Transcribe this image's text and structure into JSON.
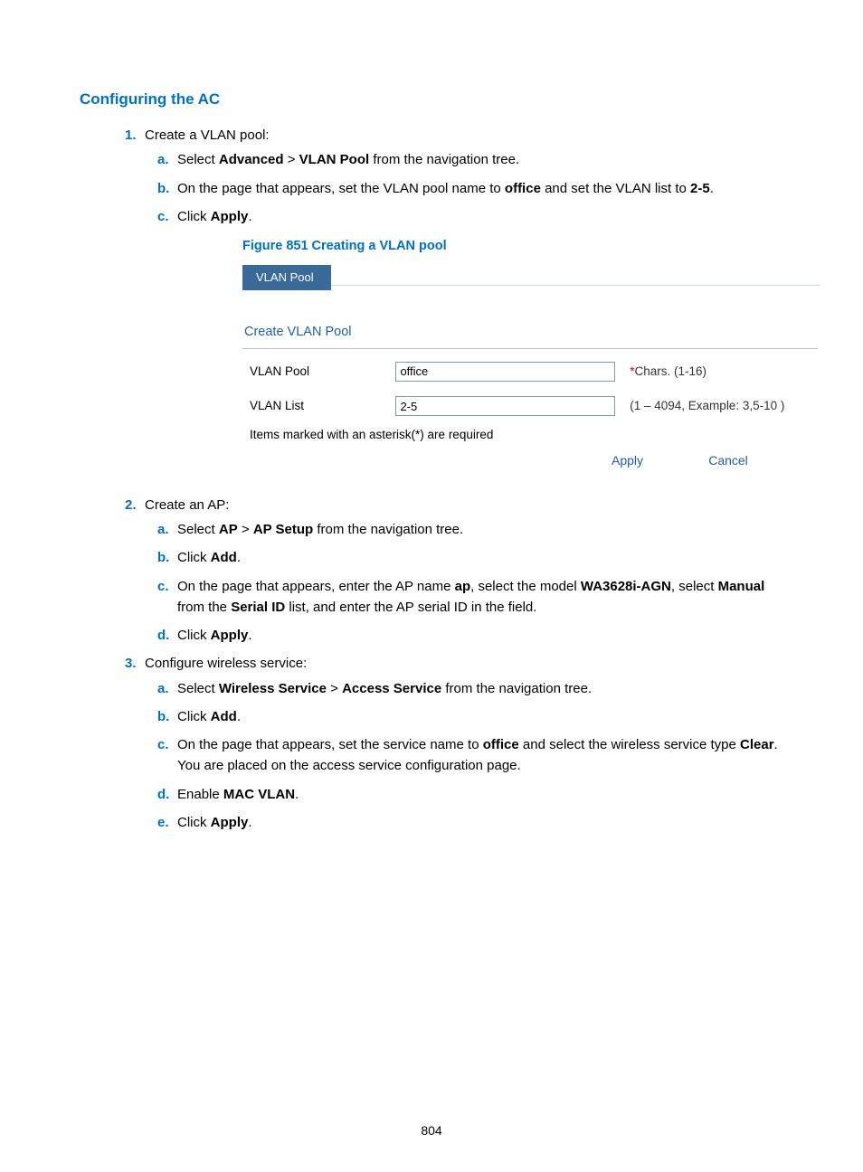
{
  "heading": "Configuring the AC",
  "step1": {
    "marker": "1.",
    "text": "Create a VLAN pool:",
    "a_marker": "a.",
    "a_pre": "Select ",
    "a_b1": "Advanced",
    "a_mid": " > ",
    "a_b2": "VLAN Pool",
    "a_post": " from the navigation tree.",
    "b_marker": "b.",
    "b_pre": "On the page that appears, set the VLAN pool name to ",
    "b_b1": "office",
    "b_mid": " and set the VLAN list to ",
    "b_b2": "2-5",
    "b_post": ".",
    "c_marker": "c.",
    "c_pre": "Click ",
    "c_b1": "Apply",
    "c_post": "."
  },
  "figure": {
    "title": "Figure 851 Creating a VLAN pool",
    "tab_label": "VLAN Pool",
    "subhead": "Create VLAN Pool",
    "row1_label": "VLAN Pool",
    "row1_value": "office",
    "row1_hint_star": "*",
    "row1_hint": "Chars. (1-16)",
    "row2_label": "VLAN List",
    "row2_value": "2-5",
    "row2_hint": "(1 – 4094, Example: 3,5-10 )",
    "required_note": "Items marked with an asterisk(*) are required",
    "apply_label": "Apply",
    "cancel_label": "Cancel"
  },
  "step2": {
    "marker": "2.",
    "text": "Create an AP:",
    "a_marker": "a.",
    "a_pre": "Select ",
    "a_b1": "AP",
    "a_mid": " > ",
    "a_b2": "AP Setup",
    "a_post": " from the navigation tree.",
    "b_marker": "b.",
    "b_pre": "Click ",
    "b_b1": "Add",
    "b_post": ".",
    "c_marker": "c.",
    "c_pre": "On the page that appears, enter the AP name ",
    "c_b1": "ap",
    "c_mid1": ", select the model ",
    "c_b2": "WA3628i-AGN",
    "c_mid2": ", select ",
    "c_b3": "Manual",
    "c_mid3": " from the ",
    "c_b4": "Serial ID",
    "c_post": " list, and enter the AP serial ID in the field.",
    "d_marker": "d.",
    "d_pre": "Click ",
    "d_b1": "Apply",
    "d_post": "."
  },
  "step3": {
    "marker": "3.",
    "text": "Configure wireless service:",
    "a_marker": "a.",
    "a_pre": "Select ",
    "a_b1": "Wireless Service",
    "a_mid": " > ",
    "a_b2": "Access Service",
    "a_post": " from the navigation tree.",
    "b_marker": "b.",
    "b_pre": "Click ",
    "b_b1": "Add",
    "b_post": ".",
    "c_marker": "c.",
    "c_pre": "On the page that appears, set the service name to ",
    "c_b1": "office",
    "c_mid": " and select the wireless service type ",
    "c_b2": "Clear",
    "c_post": ". You are placed on the access service configuration page.",
    "d_marker": "d.",
    "d_pre": "Enable ",
    "d_b1": "MAC VLAN",
    "d_post": ".",
    "e_marker": "e.",
    "e_pre": "Click ",
    "e_b1": "Apply",
    "e_post": "."
  },
  "page_number": "804"
}
